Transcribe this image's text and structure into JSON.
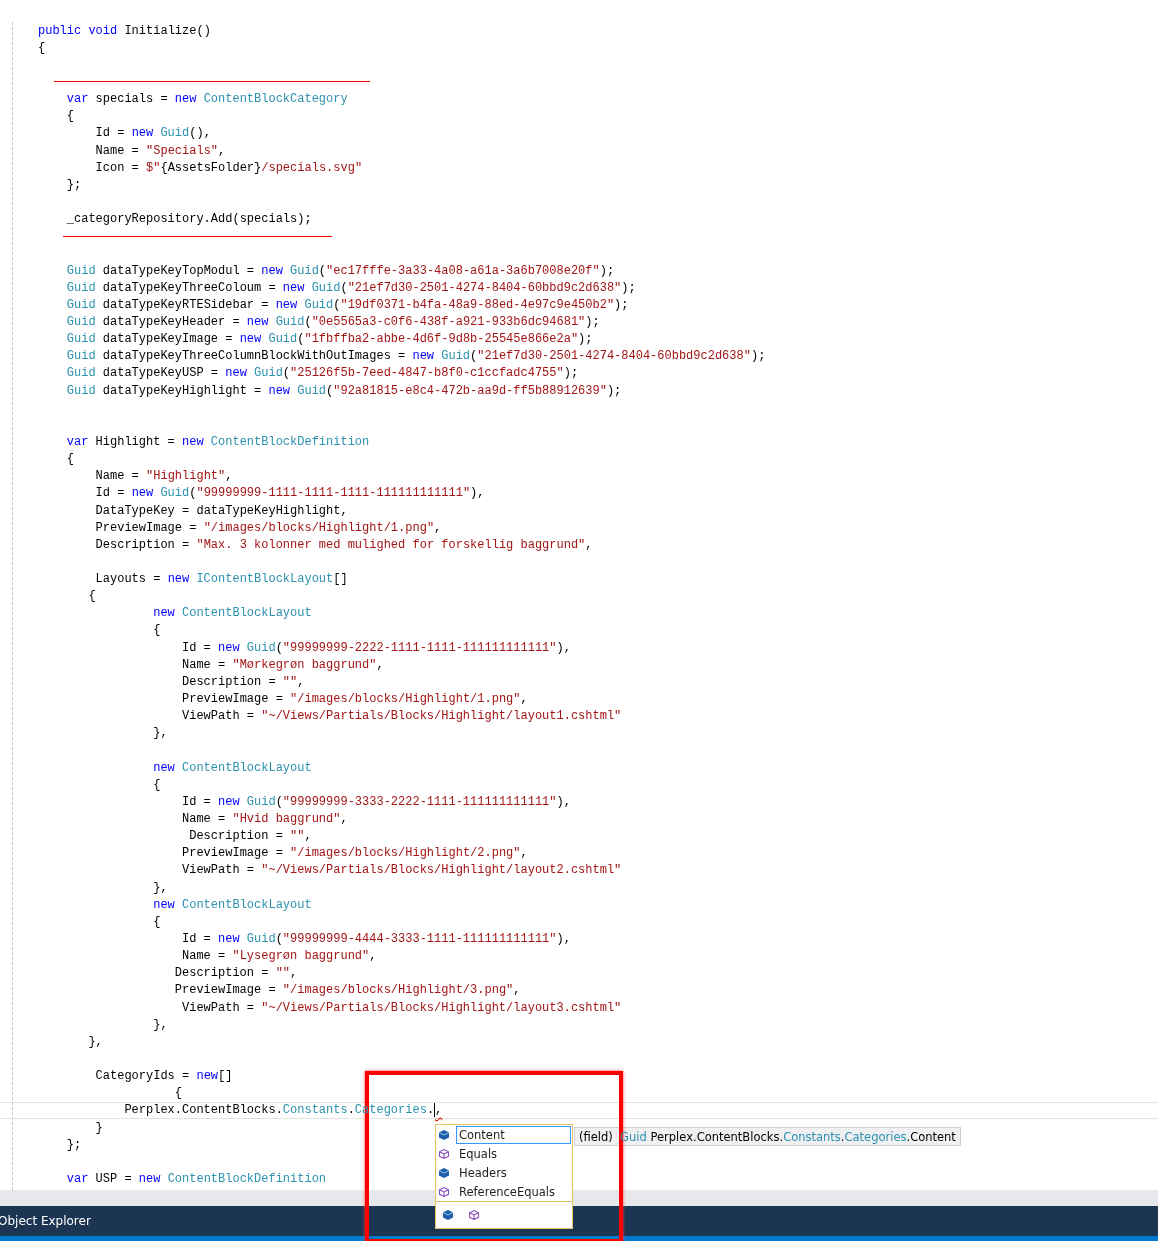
{
  "editor": {
    "lines": [
      {
        "tokens": [
          {
            "kind": "keyword",
            "text": "public void"
          },
          {
            "kind": "plain",
            "text": " Initialize()"
          }
        ]
      },
      {
        "tokens": [
          {
            "kind": "plain",
            "text": "{"
          }
        ]
      },
      {
        "kind": "blank"
      },
      {
        "kind": "underline"
      },
      {
        "tokens": [
          {
            "kind": "keyword",
            "text": "var"
          },
          {
            "kind": "plain",
            "text": " specials = "
          },
          {
            "kind": "keyword",
            "text": "new",
            "gap": true
          },
          {
            "kind": "type",
            "text": "ContentBlockCategory"
          }
        ]
      },
      {
        "tokens": [
          {
            "kind": "plain",
            "text": "{"
          }
        ]
      },
      {
        "tokens": [
          {
            "kind": "plain",
            "text": "Id = "
          },
          {
            "kind": "keyword",
            "text": "new",
            "gap": true
          },
          {
            "kind": "type",
            "text": "Guid"
          },
          {
            "kind": "plain",
            "text": "(),"
          }
        ]
      },
      {
        "tokens": [
          {
            "kind": "plain",
            "text": "Name = "
          },
          {
            "kind": "string",
            "text": "\"Specials\""
          },
          {
            "kind": "plain",
            "text": ","
          }
        ]
      },
      {
        "tokens": [
          {
            "kind": "plain",
            "text": "Icon = "
          },
          {
            "kind": "string",
            "text": "$\""
          },
          {
            "kind": "plain",
            "text": "{AssetsFolder}"
          },
          {
            "kind": "string",
            "text": "/specials.svg\""
          }
        ]
      },
      {
        "tokens": [
          {
            "kind": "plain",
            "text": "};"
          }
        ]
      },
      {
        "kind": "blank"
      },
      {
        "tokens": [
          {
            "kind": "plain",
            "text": "_categoryRepository.Add(specials);"
          }
        ]
      },
      {
        "kind": "underline"
      },
      {
        "kind": "blank"
      },
      {
        "tokens": [
          {
            "kind": "type",
            "text": "Guid"
          },
          {
            "kind": "plain",
            "text": " dataTypeKeyTopModul = "
          },
          {
            "kind": "keyword",
            "text": "new",
            "gap": true
          },
          {
            "kind": "type",
            "text": "Guid"
          },
          {
            "kind": "plain",
            "text": "("
          },
          {
            "kind": "string",
            "text": "\"ec17fffe-3a33-4a08-a61a-3a6b7008e20f\""
          },
          {
            "kind": "plain",
            "text": ");"
          }
        ]
      },
      {
        "tokens": [
          {
            "kind": "type",
            "text": "Guid"
          },
          {
            "kind": "plain",
            "text": " dataTypeKeyThreeColoum = "
          },
          {
            "kind": "keyword",
            "text": "new",
            "gap": true
          },
          {
            "kind": "type",
            "text": "Guid"
          },
          {
            "kind": "plain",
            "text": "("
          },
          {
            "kind": "string",
            "text": "\"21ef7d30-2501-4274-8404-60bbd9c2d638\""
          },
          {
            "kind": "plain",
            "text": ");"
          }
        ]
      },
      {
        "tokens": [
          {
            "kind": "type",
            "text": "Guid"
          },
          {
            "kind": "plain",
            "text": " dataTypeKeyRTESidebar = "
          },
          {
            "kind": "keyword",
            "text": "new",
            "gap": true
          },
          {
            "kind": "type",
            "text": "Guid"
          },
          {
            "kind": "plain",
            "text": "("
          },
          {
            "kind": "string",
            "text": "\"19df0371-b4fa-48a9-88ed-4e97c9e450b2\""
          },
          {
            "kind": "plain",
            "text": ");"
          }
        ]
      },
      {
        "tokens": [
          {
            "kind": "type",
            "text": "Guid"
          },
          {
            "kind": "plain",
            "text": " dataTypeKeyHeader = "
          },
          {
            "kind": "keyword",
            "text": "new",
            "gap": true
          },
          {
            "kind": "type",
            "text": "Guid"
          },
          {
            "kind": "plain",
            "text": "("
          },
          {
            "kind": "string",
            "text": "\"0e5565a3-c0f6-438f-a921-933b6dc94681\""
          },
          {
            "kind": "plain",
            "text": ");"
          }
        ]
      },
      {
        "tokens": [
          {
            "kind": "type",
            "text": "Guid"
          },
          {
            "kind": "plain",
            "text": " dataTypeKeyImage = "
          },
          {
            "kind": "keyword",
            "text": "new",
            "gap": true
          },
          {
            "kind": "type",
            "text": "Guid"
          },
          {
            "kind": "plain",
            "text": "("
          },
          {
            "kind": "string",
            "text": "\"1fbffba2-abbe-4d6f-9d8b-25545e866e2a\""
          },
          {
            "kind": "plain",
            "text": ");"
          }
        ]
      },
      {
        "tokens": [
          {
            "kind": "type",
            "text": "Guid"
          },
          {
            "kind": "plain",
            "text": " dataTypeKeyThreeColumnBlockWithOutImages = "
          },
          {
            "kind": "keyword",
            "text": "new",
            "gap": true
          },
          {
            "kind": "type",
            "text": "Guid"
          },
          {
            "kind": "plain",
            "text": "("
          },
          {
            "kind": "string",
            "text": "\"21ef7d30-2501-4274-8404-60bbd9c2d638\""
          },
          {
            "kind": "plain",
            "text": ");"
          }
        ]
      },
      {
        "tokens": [
          {
            "kind": "type",
            "text": "Guid"
          },
          {
            "kind": "plain",
            "text": " dataTypeKeyUSP = "
          },
          {
            "kind": "keyword",
            "text": "new",
            "gap": true
          },
          {
            "kind": "type",
            "text": "Guid"
          },
          {
            "kind": "plain",
            "text": "("
          },
          {
            "kind": "string",
            "text": "\"25126f5b-7eed-4847-b8f0-c1ccfadc4755\""
          },
          {
            "kind": "plain",
            "text": ");"
          }
        ]
      },
      {
        "tokens": [
          {
            "kind": "type",
            "text": "Guid"
          },
          {
            "kind": "plain",
            "text": " dataTypeKeyHighlight = "
          },
          {
            "kind": "keyword",
            "text": "new",
            "gap": true
          },
          {
            "kind": "type",
            "text": "Guid"
          },
          {
            "kind": "plain",
            "text": "("
          },
          {
            "kind": "string",
            "text": "\"92a81815-e8c4-472b-aa9d-ff5b88912639\""
          },
          {
            "kind": "plain",
            "text": ");"
          }
        ]
      },
      {
        "kind": "blank"
      },
      {
        "kind": "blank"
      },
      {
        "tokens": [
          {
            "kind": "keyword",
            "text": "var"
          },
          {
            "kind": "plain",
            "text": " Highlight = "
          },
          {
            "kind": "keyword",
            "text": "new",
            "gap": true
          },
          {
            "kind": "type",
            "text": "ContentBlockDefinition"
          }
        ]
      },
      {
        "tokens": [
          {
            "kind": "plain",
            "text": "{"
          }
        ]
      },
      {
        "tokens": [
          {
            "kind": "plain",
            "text": "Name = "
          },
          {
            "kind": "string",
            "text": "\"Highlight\""
          },
          {
            "kind": "plain",
            "text": ","
          }
        ]
      },
      {
        "tokens": [
          {
            "kind": "plain",
            "text": "Id = "
          },
          {
            "kind": "keyword",
            "text": "new",
            "gap": true
          },
          {
            "kind": "type",
            "text": "Guid"
          },
          {
            "kind": "plain",
            "text": "("
          },
          {
            "kind": "string",
            "text": "\"99999999-1111-1111-1111-111111111111\""
          },
          {
            "kind": "plain",
            "text": "),"
          }
        ]
      },
      {
        "tokens": [
          {
            "kind": "plain",
            "text": "DataTypeKey = dataTypeKeyHighlight,"
          }
        ]
      },
      {
        "tokens": [
          {
            "kind": "plain",
            "text": "PreviewImage = "
          },
          {
            "kind": "string",
            "text": "\"/images/blocks/Highlight/1.png\""
          },
          {
            "kind": "plain",
            "text": ","
          }
        ]
      },
      {
        "tokens": [
          {
            "kind": "plain",
            "text": "Description = "
          },
          {
            "kind": "string",
            "text": "\"Max. 3 kolonner med mulighed for forskellig baggrund\""
          },
          {
            "kind": "plain",
            "text": ","
          }
        ]
      },
      {
        "kind": "blank"
      },
      {
        "tokens": [
          {
            "kind": "plain",
            "text": "Layouts = "
          },
          {
            "kind": "keyword",
            "text": "new",
            "gap": true
          },
          {
            "kind": "type",
            "text": "IContentBlockLayout"
          },
          {
            "kind": "plain",
            "text": "[]"
          }
        ]
      },
      {
        "tokens": [
          {
            "kind": "plain",
            "text": "{"
          }
        ]
      },
      {
        "tokens": [
          {
            "kind": "keyword",
            "text": "new",
            "gap": true
          },
          {
            "kind": "type",
            "text": "ContentBlockLayout"
          }
        ]
      },
      {
        "tokens": [
          {
            "kind": "plain",
            "text": "{"
          }
        ]
      },
      {
        "tokens": [
          {
            "kind": "plain",
            "text": "Id = "
          },
          {
            "kind": "keyword",
            "text": "new",
            "gap": true
          },
          {
            "kind": "type",
            "text": "Guid"
          },
          {
            "kind": "plain",
            "text": "("
          },
          {
            "kind": "string",
            "text": "\"99999999-2222-1111-1111-111111111111\""
          },
          {
            "kind": "plain",
            "text": "),"
          }
        ]
      },
      {
        "tokens": [
          {
            "kind": "plain",
            "text": "Name = "
          },
          {
            "kind": "string",
            "text": "\"Mørkegrøn baggrund\""
          },
          {
            "kind": "plain",
            "text": ","
          }
        ]
      },
      {
        "tokens": [
          {
            "kind": "plain",
            "text": "Description = "
          },
          {
            "kind": "string",
            "text": "\"\""
          },
          {
            "kind": "plain",
            "text": ","
          }
        ]
      },
      {
        "tokens": [
          {
            "kind": "plain",
            "text": "PreviewImage = "
          },
          {
            "kind": "string",
            "text": "\"/images/blocks/Highlight/1.png\""
          },
          {
            "kind": "plain",
            "text": ","
          }
        ]
      },
      {
        "tokens": [
          {
            "kind": "plain",
            "text": "ViewPath = "
          },
          {
            "kind": "string",
            "text": "\"~/Views/Partials/Blocks/Highlight/layout1.cshtml\""
          }
        ]
      },
      {
        "tokens": [
          {
            "kind": "plain",
            "text": "},"
          }
        ]
      },
      {
        "kind": "blank"
      },
      {
        "tokens": [
          {
            "kind": "keyword",
            "text": "new",
            "gap": true
          },
          {
            "kind": "type",
            "text": "ContentBlockLayout"
          }
        ]
      },
      {
        "tokens": [
          {
            "kind": "plain",
            "text": "{"
          }
        ]
      },
      {
        "tokens": [
          {
            "kind": "plain",
            "text": "Id = "
          },
          {
            "kind": "keyword",
            "text": "new",
            "gap": true
          },
          {
            "kind": "type",
            "text": "Guid"
          },
          {
            "kind": "plain",
            "text": "("
          },
          {
            "kind": "string",
            "text": "\"99999999-3333-2222-1111-111111111111\""
          },
          {
            "kind": "plain",
            "text": "),"
          }
        ]
      },
      {
        "tokens": [
          {
            "kind": "plain",
            "text": "Name = "
          },
          {
            "kind": "string",
            "text": "\"Hvid baggrund\""
          },
          {
            "kind": "plain",
            "text": ","
          }
        ]
      },
      {
        "tokens": [
          {
            "kind": "plain",
            "text": "Description = "
          },
          {
            "kind": "string",
            "text": "\"\""
          },
          {
            "kind": "plain",
            "text": ","
          }
        ]
      },
      {
        "tokens": [
          {
            "kind": "plain",
            "text": "PreviewImage = "
          },
          {
            "kind": "string",
            "text": "\"/images/blocks/Highlight/2.png\""
          },
          {
            "kind": "plain",
            "text": ","
          }
        ]
      },
      {
        "tokens": [
          {
            "kind": "plain",
            "text": "ViewPath = "
          },
          {
            "kind": "string",
            "text": "\"~/Views/Partials/Blocks/Highlight/layout2.cshtml\""
          }
        ]
      },
      {
        "tokens": [
          {
            "kind": "plain",
            "text": "},"
          }
        ]
      },
      {
        "tokens": [
          {
            "kind": "keyword",
            "text": "new",
            "gap": true
          },
          {
            "kind": "type",
            "text": "ContentBlockLayout"
          }
        ]
      },
      {
        "tokens": [
          {
            "kind": "plain",
            "text": "{"
          }
        ]
      },
      {
        "tokens": [
          {
            "kind": "plain",
            "text": "Id = "
          },
          {
            "kind": "keyword",
            "text": "new",
            "gap": true
          },
          {
            "kind": "type",
            "text": "Guid"
          },
          {
            "kind": "plain",
            "text": "("
          },
          {
            "kind": "string",
            "text": "\"99999999-4444-3333-1111-111111111111\""
          },
          {
            "kind": "plain",
            "text": "),"
          }
        ]
      },
      {
        "tokens": [
          {
            "kind": "plain",
            "text": "Name = "
          },
          {
            "kind": "string",
            "text": "\"Lysegrøn baggrund\""
          },
          {
            "kind": "plain",
            "text": ","
          }
        ]
      },
      {
        "tokens": [
          {
            "kind": "plain",
            "text": "Description = "
          },
          {
            "kind": "string",
            "text": "\"\""
          },
          {
            "kind": "plain",
            "text": ","
          }
        ]
      },
      {
        "tokens": [
          {
            "kind": "plain",
            "text": "PreviewImage = "
          },
          {
            "kind": "string",
            "text": "\"/images/blocks/Highlight/3.png\""
          },
          {
            "kind": "plain",
            "text": ","
          }
        ]
      },
      {
        "tokens": [
          {
            "kind": "plain",
            "text": "ViewPath = "
          },
          {
            "kind": "string",
            "text": "\"~/Views/Partials/Blocks/Highlight/layout3.cshtml\""
          }
        ]
      },
      {
        "tokens": [
          {
            "kind": "plain",
            "text": "},"
          }
        ]
      },
      {
        "tokens": [
          {
            "kind": "plain",
            "text": "},"
          }
        ]
      },
      {
        "kind": "blank"
      },
      {
        "tokens": [
          {
            "kind": "plain",
            "text": "CategoryIds = "
          },
          {
            "kind": "keyword",
            "text": "new"
          },
          {
            "kind": "plain",
            "text": "[]"
          }
        ]
      },
      {
        "tokens": [
          {
            "kind": "plain",
            "text": "{"
          }
        ]
      },
      {
        "current": true,
        "tokens": [
          {
            "kind": "plain",
            "text": "Perplex.ContentBlocks."
          },
          {
            "kind": "type",
            "text": "Constants"
          },
          {
            "kind": "plain",
            "text": "."
          },
          {
            "kind": "type",
            "text": "Categories"
          },
          {
            "kind": "plain",
            "text": "."
          },
          {
            "kind": "caret"
          },
          {
            "kind": "error",
            "text": ","
          }
        ]
      },
      {
        "tokens": [
          {
            "kind": "plain",
            "text": "}"
          }
        ]
      },
      {
        "tokens": [
          {
            "kind": "plain",
            "text": "};"
          }
        ]
      },
      {
        "kind": "blank"
      },
      {
        "tokens": [
          {
            "kind": "keyword",
            "text": "var"
          },
          {
            "kind": "plain",
            "text": " USP = "
          },
          {
            "kind": "keyword",
            "text": "new",
            "gap": true
          },
          {
            "kind": "type",
            "text": "ContentBlockDefinition"
          }
        ]
      }
    ]
  },
  "completion": {
    "items": [
      {
        "kind": "field",
        "label": "Content",
        "selected": true
      },
      {
        "kind": "method",
        "label": "Equals",
        "selected": false
      },
      {
        "kind": "field",
        "label": "Headers",
        "selected": false
      },
      {
        "kind": "method",
        "label": "ReferenceEquals",
        "selected": false
      }
    ],
    "filters": [
      {
        "kind": "field"
      },
      {
        "kind": "method"
      }
    ]
  },
  "tooltip": {
    "tokens": [
      {
        "kind": "plain",
        "text": "(field)",
        "gap": true
      },
      {
        "kind": "type",
        "text": "Guid"
      },
      {
        "kind": "plain",
        "text": " Perplex.ContentBlocks."
      },
      {
        "kind": "type",
        "text": "Constants"
      },
      {
        "kind": "plain",
        "text": "."
      },
      {
        "kind": "type",
        "text": "Categories"
      },
      {
        "kind": "plain",
        "text": ".Content"
      }
    ]
  },
  "panel_tab": {
    "label": "Object Explorer"
  }
}
